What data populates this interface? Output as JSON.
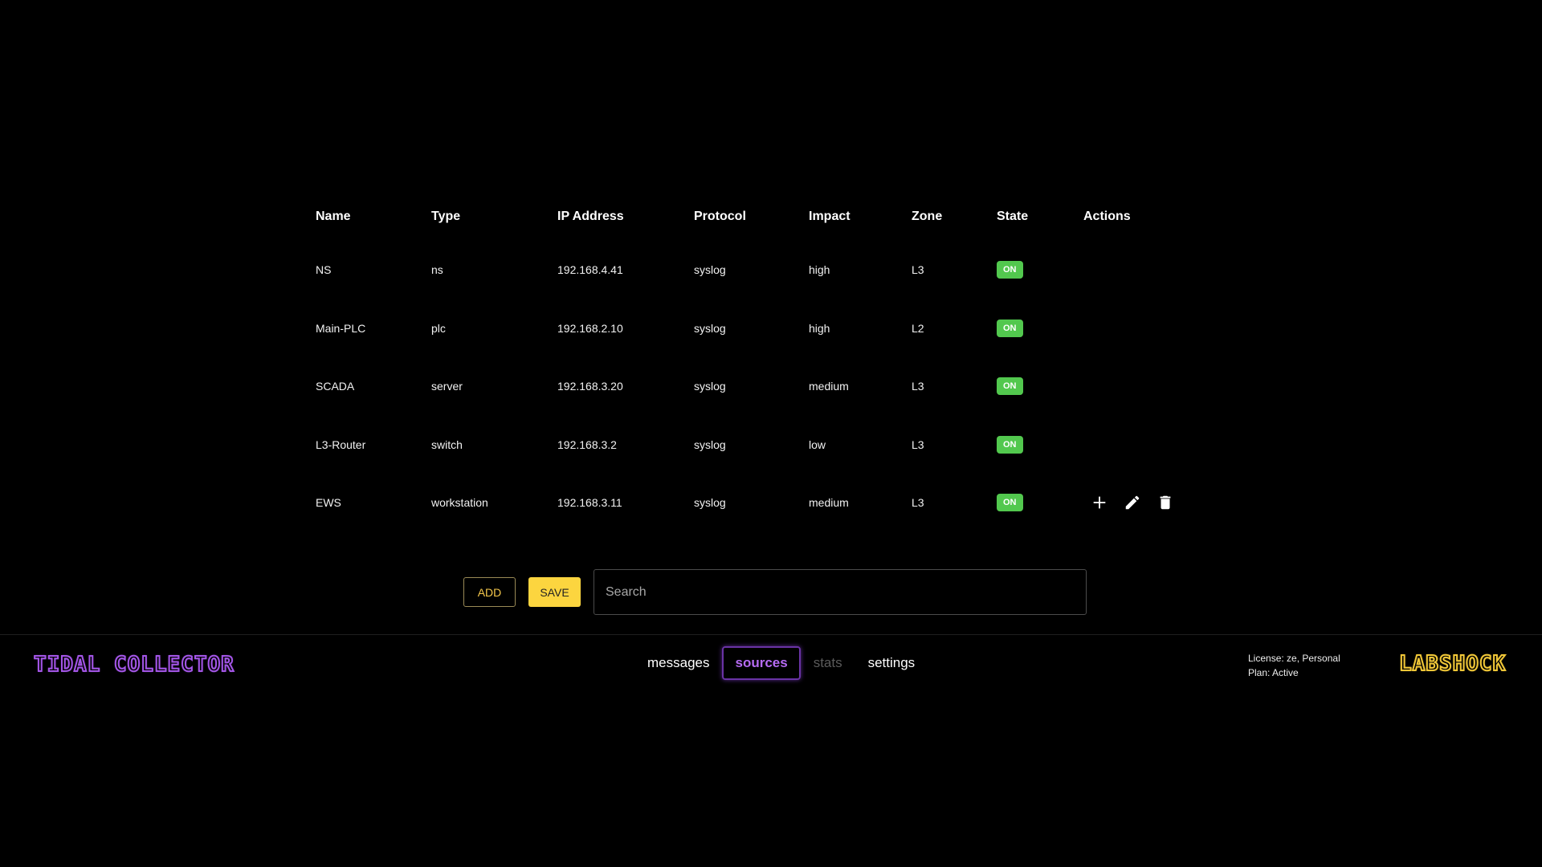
{
  "table": {
    "headers": [
      "Name",
      "Type",
      "IP Address",
      "Protocol",
      "Impact",
      "Zone",
      "State",
      "Actions"
    ],
    "rows": [
      {
        "name": "NS",
        "type": "ns",
        "ip": "192.168.4.41",
        "protocol": "syslog",
        "impact": "high",
        "zone": "L3",
        "state": "ON"
      },
      {
        "name": "Main-PLC",
        "type": "plc",
        "ip": "192.168.2.10",
        "protocol": "syslog",
        "impact": "high",
        "zone": "L2",
        "state": "ON"
      },
      {
        "name": "SCADA",
        "type": "server",
        "ip": "192.168.3.20",
        "protocol": "syslog",
        "impact": "medium",
        "zone": "L3",
        "state": "ON"
      },
      {
        "name": "L3-Router",
        "type": "switch",
        "ip": "192.168.3.2",
        "protocol": "syslog",
        "impact": "low",
        "zone": "L3",
        "state": "ON"
      },
      {
        "name": "EWS",
        "type": "workstation",
        "ip": "192.168.3.11",
        "protocol": "syslog",
        "impact": "medium",
        "zone": "L3",
        "state": "ON"
      }
    ],
    "row_actions_icons": [
      "plus-icon",
      "pencil-icon",
      "trash-icon"
    ]
  },
  "controls": {
    "add_label": "ADD",
    "save_label": "SAVE",
    "search_placeholder": "Search"
  },
  "footer": {
    "brand_left": "TIDAL COLLECTOR",
    "nav": [
      {
        "label": "messages",
        "state": "normal"
      },
      {
        "label": "sources",
        "state": "active"
      },
      {
        "label": "stats",
        "state": "disabled"
      },
      {
        "label": "settings",
        "state": "normal"
      }
    ],
    "license_line": "License: ze, Personal",
    "plan_line": "Plan: Active",
    "brand_right": "LABSHOCK"
  },
  "colors": {
    "background": "#000000",
    "state_on": "#52c84e",
    "accent_purple": "#a456e8",
    "accent_yellow": "#fcd53f"
  }
}
